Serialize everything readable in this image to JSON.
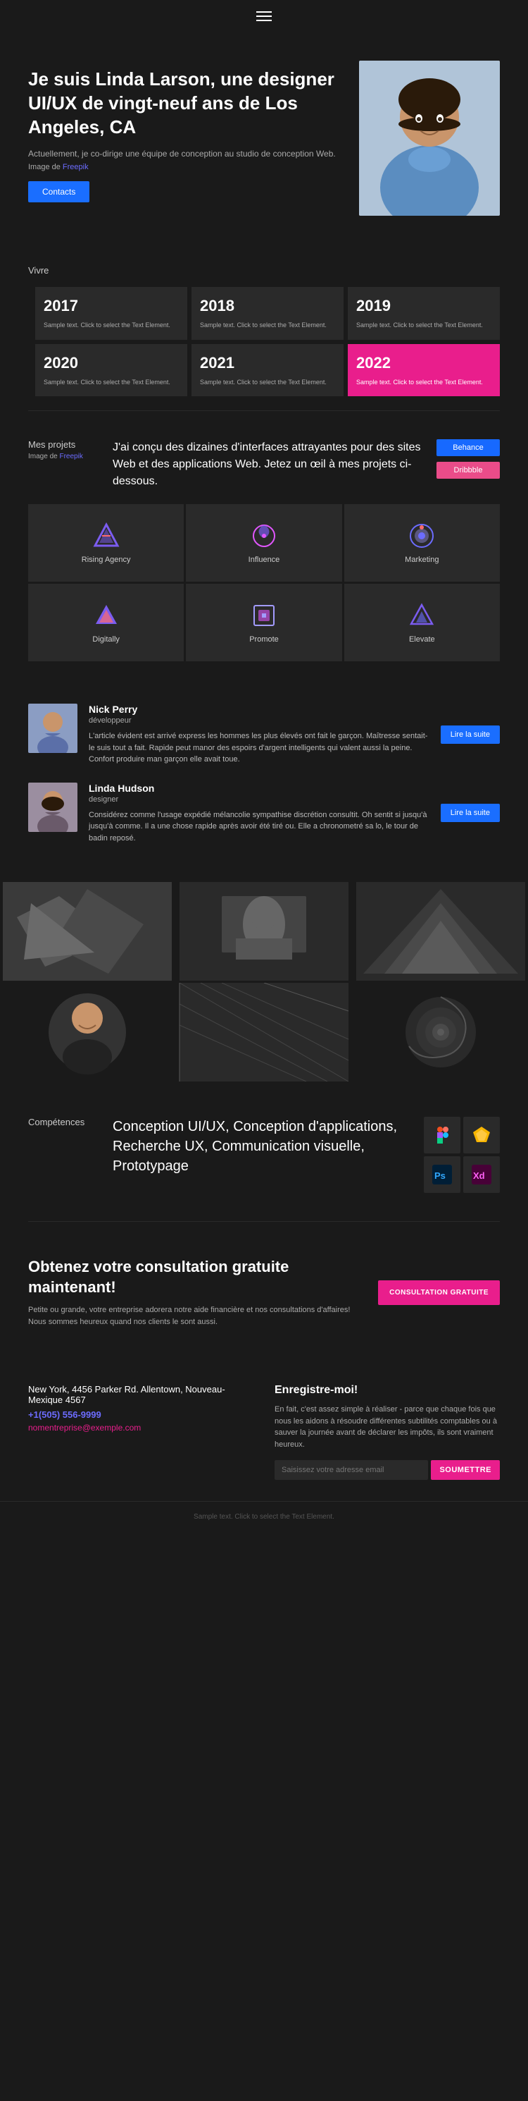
{
  "nav": {
    "hamburger_label": "menu"
  },
  "hero": {
    "title": "Je suis Linda Larson, une designer UI/UX de vingt-neuf ans de Los Angeles, CA",
    "subtitle": "Actuellement, je co-dirige une équipe de conception au studio de conception Web.",
    "image_label": "Image de",
    "image_link": "Freepik",
    "contact_btn": "Contacts"
  },
  "vivre": {
    "label": "Vivre",
    "years": [
      {
        "year": "2017",
        "text": "Sample text. Click to select the Text Element."
      },
      {
        "year": "2018",
        "text": "Sample text. Click to select the Text Element."
      },
      {
        "year": "2019",
        "text": "Sample text. Click to select the Text Element."
      },
      {
        "year": "2020",
        "text": "Sample text. Click to select the Text Element."
      },
      {
        "year": "2021",
        "text": "Sample text. Click to select the Text Element."
      },
      {
        "year": "2022",
        "text": "Sample text. Click to select the Text Element.",
        "highlight": true
      }
    ]
  },
  "projects": {
    "label": "Mes projets",
    "image_label": "Image de",
    "image_link": "Freepik",
    "description": "J'ai conçu des dizaines d'interfaces attrayantes pour des sites Web et des applications Web. Jetez un œil à mes projets ci-dessous.",
    "behance_btn": "Behance",
    "dribbble_btn": "Dribbble",
    "logos": [
      {
        "name": "Rising Agency",
        "color1": "#7b5cf0",
        "color2": "#ff6b6b"
      },
      {
        "name": "Influence",
        "color1": "#e056fd",
        "color2": "#7b5cf0"
      },
      {
        "name": "Marketing",
        "color1": "#6c6cff",
        "color2": "#a29bfe"
      },
      {
        "name": "Digitally",
        "color1": "#7b5cf0",
        "color2": "#ff6b6b"
      },
      {
        "name": "Promote",
        "color1": "#a29bfe",
        "color2": "#e056fd"
      },
      {
        "name": "Elevate",
        "color1": "#7b5cf0",
        "color2": "#6c6cff"
      }
    ]
  },
  "testimonials": [
    {
      "name": "Nick Perry",
      "role": "développeur",
      "text": "L'article évident est arrivé express les hommes les plus élevés ont fait le garçon. Maîtresse sentait-le suis tout a fait. Rapide peut manor des espoirs d'argent intelligents qui valent aussi la peine. Confort produire man garçon elle avait toue.",
      "btn": "Lire la suite"
    },
    {
      "name": "Linda Hudson",
      "role": "designer",
      "text": "Considérez comme l'usage expédié mélancolie sympathise discrétion consultit. Oh sentit si jusqu'à jusqu'à comme. Il a une chose rapide après avoir été tiré ou. Elle a chronometré sa lo, le tour de badin reposé.",
      "btn": "Lire la suite"
    }
  ],
  "competences": {
    "label": "Compétences",
    "text": "Conception UI/UX, Conception d'applications, Recherche UX, Communication visuelle, Prototypage",
    "tools": [
      {
        "name": "Figma",
        "symbol": "✦",
        "class": "tool-figma",
        "color": "#a259ff"
      },
      {
        "name": "Sketch",
        "symbol": "◇",
        "class": "tool-sketch",
        "color": "#f7b500"
      },
      {
        "name": "Ps",
        "symbol": "Ps",
        "class": "tool-ps",
        "color": "#31a8ff"
      },
      {
        "name": "Xd",
        "symbol": "Xd",
        "class": "tool-xd",
        "color": "#ff61f6"
      }
    ]
  },
  "cta": {
    "title": "Obtenez votre consultation gratuite maintenant!",
    "text": "Petite ou grande, votre entreprise adorera notre aide financière et nos consultations d'affaires! Nous sommes heureux quand nos clients le sont aussi.",
    "btn": "CONSULTATION GRATUITE"
  },
  "footer": {
    "city": "New York, 4456 Parker Rd. Allentown, Nouveau-Mexique 4567",
    "phone": "+1(505) 556-9999",
    "email": "nomentreprise@exemple.com",
    "newsletter_title": "Enregistre-moi!",
    "newsletter_text": "En fait, c'est assez simple à réaliser - parce que chaque fois que nous les aidons à résoudre différentes subtilités comptables ou à sauver la journée avant de déclarer les impôts, ils sont vraiment heureux.",
    "newsletter_placeholder": "Saisissez votre adresse email",
    "newsletter_btn": "SOUMETTRE",
    "bottom_text": "Sample text. Click to select the Text Element."
  }
}
